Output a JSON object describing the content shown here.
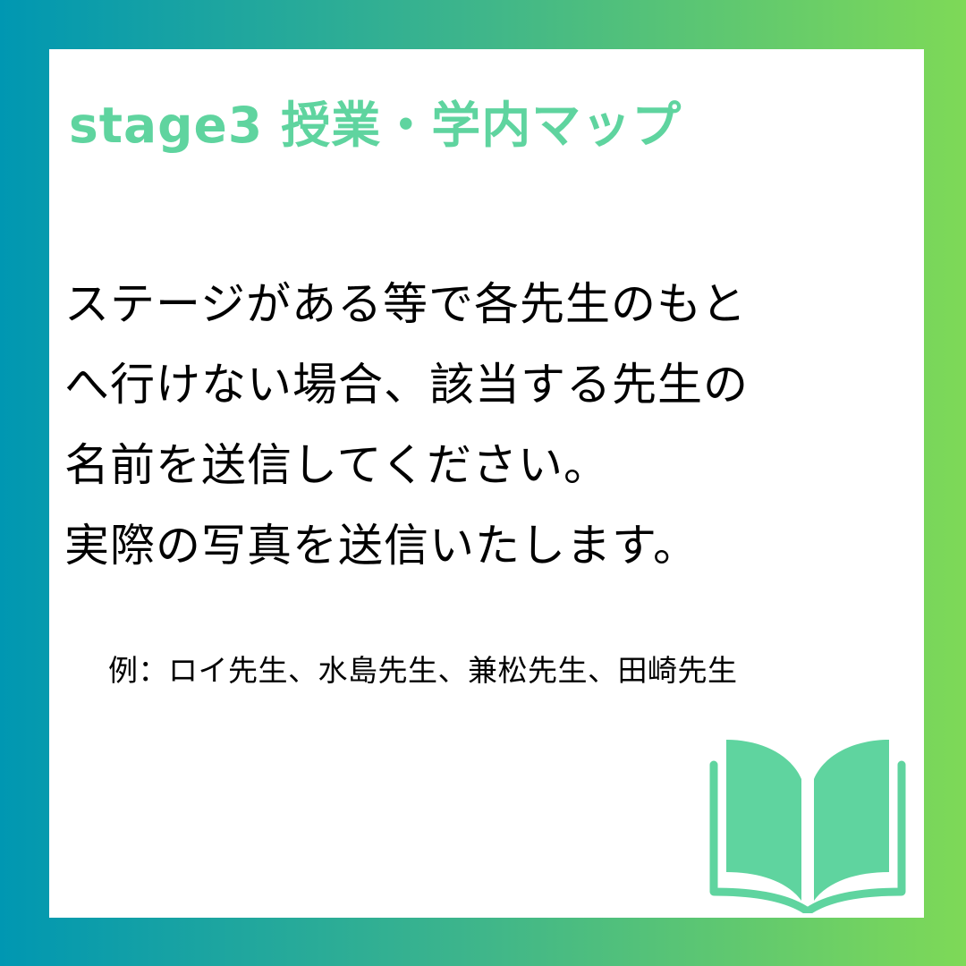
{
  "title": "stage3 授業・学内マップ",
  "body_lines": [
    "ステージがある等で各先生のもと",
    "へ行けない場合、該当する先生の",
    "名前を送信してください。",
    "実際の写真を送信いたします。"
  ],
  "example": "例：ロイ先生、水島先生、兼松先生、田崎先生",
  "icons": {
    "book": "open-book-icon"
  },
  "colors": {
    "accent": "#5fd49f",
    "gradient_start": "#0097b2",
    "gradient_end": "#7ed957",
    "card": "#ffffff",
    "text": "#000000"
  }
}
